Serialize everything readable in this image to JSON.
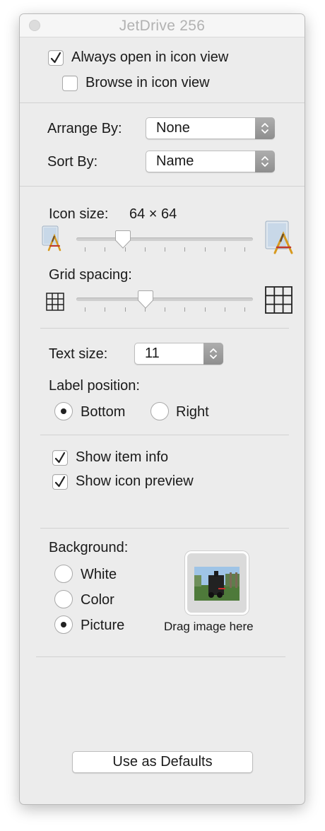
{
  "window": {
    "title": "JetDrive 256"
  },
  "open_options": {
    "always_open_label": "Always open in icon view",
    "always_open_checked": true,
    "browse_label": "Browse in icon view",
    "browse_checked": false
  },
  "arrange": {
    "arrange_label": "Arrange By:",
    "arrange_value": "None",
    "sort_label": "Sort By:",
    "sort_value": "Name"
  },
  "icon_size": {
    "label": "Icon size:",
    "value": "64 × 64",
    "slider_fraction": 0.24
  },
  "grid_spacing": {
    "label": "Grid spacing:",
    "slider_fraction": 0.38
  },
  "text": {
    "size_label": "Text size:",
    "size_value": "11",
    "label_position_label": "Label position:",
    "bottom_label": "Bottom",
    "right_label": "Right",
    "selected_position": "Bottom"
  },
  "show": {
    "item_info_label": "Show item info",
    "item_info_checked": true,
    "icon_preview_label": "Show icon preview",
    "icon_preview_checked": true
  },
  "background": {
    "label": "Background:",
    "white_label": "White",
    "color_label": "Color",
    "picture_label": "Picture",
    "selected": "Picture",
    "drop_label": "Drag image here"
  },
  "footer": {
    "defaults_button": "Use as Defaults"
  },
  "icons": {
    "small_app": "app-icon-small",
    "large_app": "app-icon-large",
    "grid_small": "grid-small-icon",
    "grid_large": "grid-large-icon",
    "close": "close-icon"
  },
  "colors": {
    "window_bg": "#ececec",
    "stepper": "#9a9a9a",
    "title_text": "#b2b2b2"
  }
}
